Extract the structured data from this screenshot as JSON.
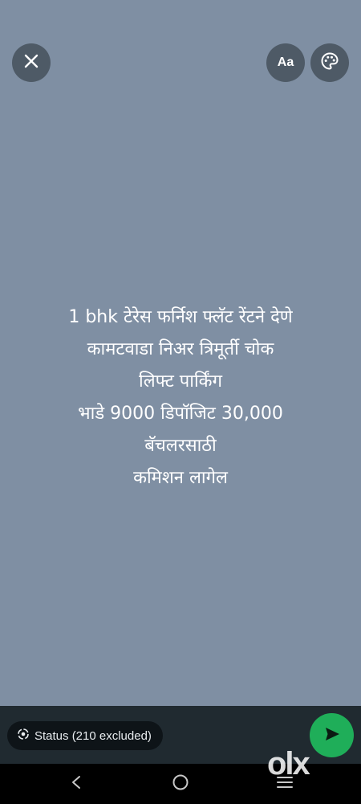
{
  "toolbar": {
    "font_button_label": "Aa"
  },
  "status": {
    "lines": [
      "1 bhk टेरेस फर्निश फ्लॅट रेंटने देणे",
      "कामटवाडा निअर त्रिमूर्ती चोक",
      "लिफ्ट पार्किंग",
      "भाडे 9000 डिपॉजिट 30,000",
      "बॅचलरसाठी",
      "कमिशन लागेल"
    ],
    "background_color": "#7f8fa3"
  },
  "composer": {
    "audience_label": "Status (210 excluded)"
  },
  "watermark": {
    "text": "olx"
  },
  "colors": {
    "send_button": "#1fae59",
    "bottom_bar": "#202a30"
  }
}
